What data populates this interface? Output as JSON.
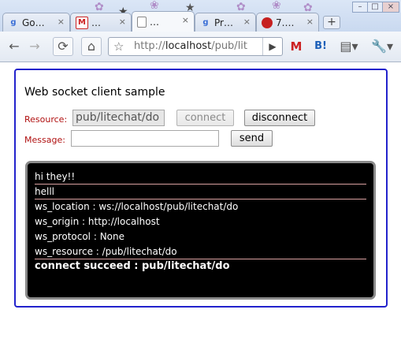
{
  "browser": {
    "tabs": [
      {
        "title": "Go…",
        "favicon": "google-icon"
      },
      {
        "title": "…",
        "favicon": "gmail-icon"
      },
      {
        "title": "…",
        "favicon": "page-icon"
      },
      {
        "title": "Pr…",
        "favicon": "google-icon"
      },
      {
        "title": "7.…",
        "favicon": "red-circle-icon"
      }
    ],
    "url_prefix": "http://",
    "url_host": "localhost",
    "url_path": "/pub/lit",
    "toolbar_bookmark_label": "B!"
  },
  "page": {
    "title": "Web socket client sample",
    "resource_label": "Resource:",
    "resource_value": "pub/litechat/do",
    "message_label": "Message:",
    "message_value": "",
    "connect_button": "connect",
    "disconnect_button": "disconnect",
    "send_button": "send"
  },
  "log": [
    "hi they!!",
    "helll",
    "ws_location : ws://localhost/pub/litechat/do",
    "ws_origin : http://localhost",
    "ws_protocol : None",
    "ws_resource : /pub/litechat/do",
    "connect succeed : pub/litechat/do"
  ],
  "colors": {
    "frame_border": "#2222cc",
    "label_color": "#b01010",
    "console_bg": "#000000",
    "separator": "#d9a0a0"
  }
}
